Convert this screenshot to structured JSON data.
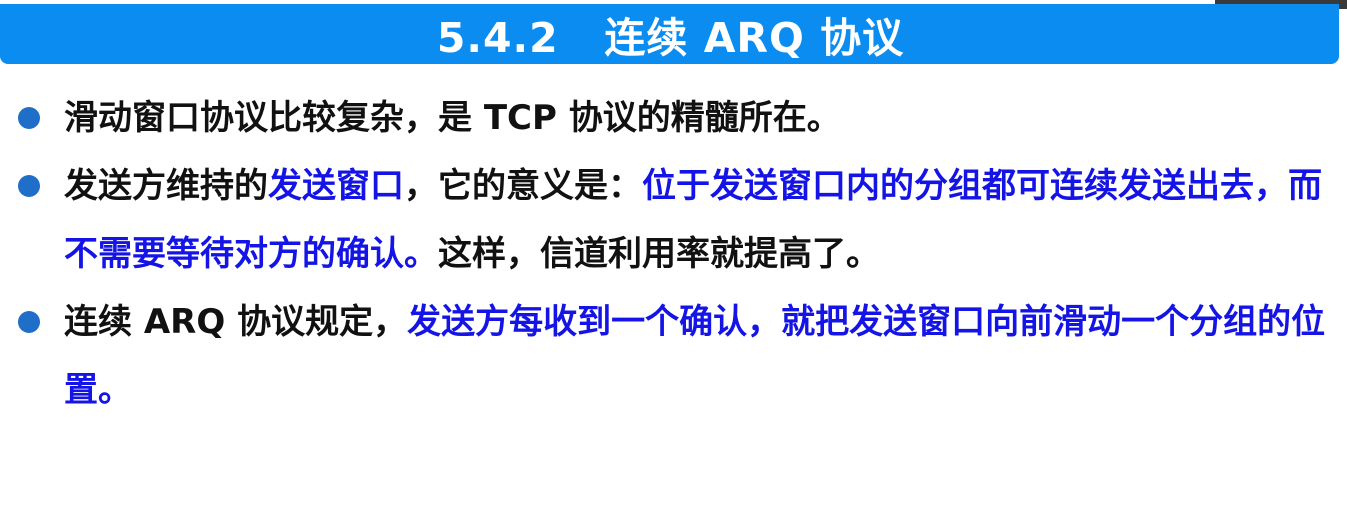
{
  "title": "5.4.2   连续 ARQ 协议",
  "colors": {
    "title_bar": "#0a8cf0",
    "bullet_dot": "#1f6fc8",
    "highlight": "#1414e6",
    "text": "#111111"
  },
  "bullets": [
    {
      "seg0": "滑动窗口协议比较复杂，是 TCP 协议的精髓所在。"
    },
    {
      "seg0": "发送方维持的",
      "seg1": "发送窗口",
      "seg2": "，它的意义是：",
      "seg3": "位于发送窗口内的分组都可连续发送出去，而不需要等待对方的确认。",
      "seg4": "这样，信道利用率就提高了。"
    },
    {
      "seg0": "连续 ARQ 协议规定，",
      "seg1": "发送方每收到一个确认，就把发送窗口向前滑动一个分组的位置。"
    }
  ]
}
